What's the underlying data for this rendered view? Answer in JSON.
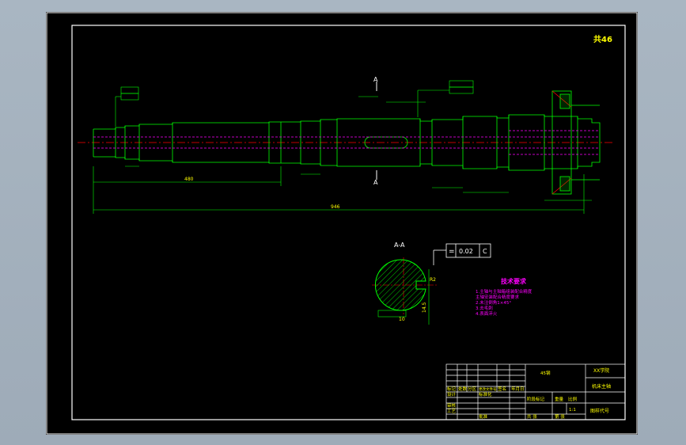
{
  "title_mark": "共46",
  "section_label": "A-A",
  "section_marker_top": "A",
  "section_marker_bottom": "A",
  "tolerance_frame": {
    "symbol": "=",
    "value": "0.02",
    "datum": "C"
  },
  "tech_requirements": {
    "heading": "技术要求",
    "items": [
      "1.主轴与主轴箱组装配合精度",
      "  主轴安装配合精度要求",
      "2.未注倒角1×45°",
      "3.去毛刺",
      "4.表面淬火"
    ]
  },
  "title_block": {
    "material": "45钢",
    "school": "XX学院",
    "part_name": "机床主轴",
    "scale": "1:1",
    "drawing_no": "图样代号",
    "row_labels": [
      "标记",
      "处数",
      "分区",
      "更改文件号",
      "签名",
      "年月日"
    ],
    "design": "设计",
    "check": "审核",
    "process": "工艺",
    "standard": "标准化",
    "stage": "阶段标记",
    "weight": "重量",
    "ratio": "比例",
    "sheet_total": "共 张",
    "sheet_no": "第 张",
    "approve": "批准"
  },
  "dimensions": {
    "overall_length": "946",
    "middle_length": "480",
    "keyway_depth": "14.5",
    "section_width": "10",
    "section_radius": "R2"
  },
  "colors": {
    "background": "#000000",
    "frame": "#ffffff",
    "outline": "#00ff00",
    "dimension": "#00ff00",
    "centerline": "#ff0000",
    "hidden": "#ff00ff",
    "text_yellow": "#ffff00",
    "text_magenta": "#ff00ff"
  }
}
